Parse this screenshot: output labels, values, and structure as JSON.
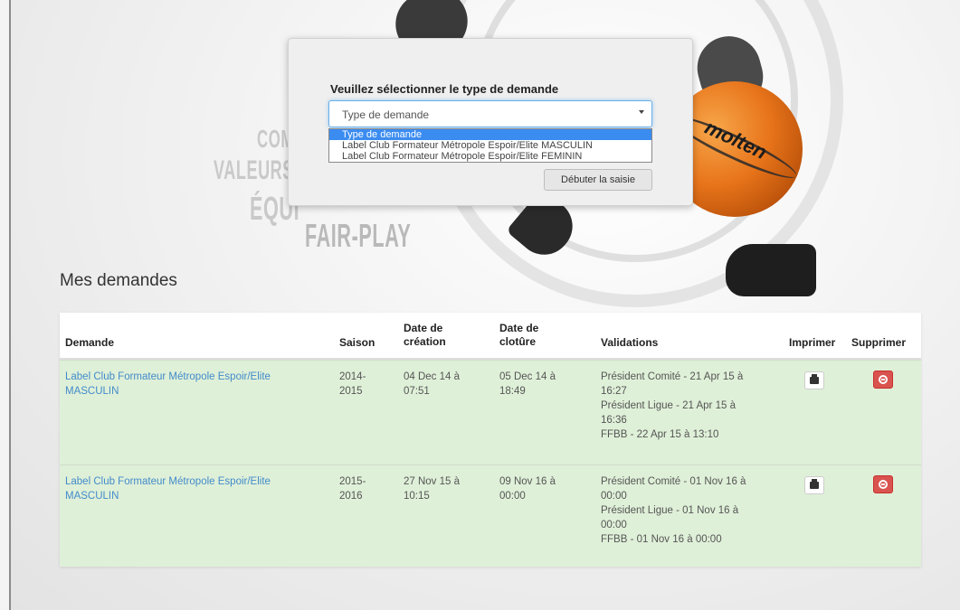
{
  "hero": {
    "words": [
      "COM",
      "VALEURS",
      "ÉQUI",
      "FAIR-PLAY"
    ],
    "ball_brand": "molten"
  },
  "modal": {
    "title": "Veuillez sélectionner le type de demande",
    "select_value": "Type de demande",
    "options": [
      "Type de demande",
      "Label Club Formateur Métropole Espoir/Elite MASCULIN",
      "Label Club Formateur Métropole Espoir/Elite FEMININ"
    ],
    "selected_option_index": 0,
    "start_button": "Débuter la saisie"
  },
  "section": {
    "title": "Mes demandes"
  },
  "table": {
    "headers": {
      "demande": "Demande",
      "saison": "Saison",
      "creation_l1": "Date de",
      "creation_l2": "création",
      "cloture_l1": "Date de",
      "cloture_l2": "clotûre",
      "validations": "Validations",
      "imprimer": "Imprimer",
      "supprimer": "Supprimer"
    },
    "rows": [
      {
        "demande_l1": "Label Club Formateur Métropole Espoir/Elite",
        "demande_l2": "MASCULIN",
        "saison_l1": "2014-",
        "saison_l2": "2015",
        "creation_l1": "04 Dec 14 à",
        "creation_l2": "07:51",
        "cloture_l1": "05 Dec 14 à",
        "cloture_l2": "18:49",
        "validations": [
          "Président Comité - 21 Apr 15 à",
          "16:27",
          "Président Ligue - 21 Apr 15 à",
          "16:36",
          "FFBB - 22 Apr 15 à 13:10"
        ]
      },
      {
        "demande_l1": "Label Club Formateur Métropole Espoir/Elite",
        "demande_l2": "MASCULIN",
        "saison_l1": "2015-",
        "saison_l2": "2016",
        "creation_l1": "27 Nov 15 à",
        "creation_l2": "10:15",
        "cloture_l1": "09 Nov 16 à",
        "cloture_l2": "00:00",
        "validations": [
          "Président Comité - 01 Nov 16 à",
          "00:00",
          "Président Ligue - 01 Nov 16 à",
          "00:00",
          "FFBB - 01 Nov 16 à 00:00"
        ]
      }
    ]
  },
  "colors": {
    "row_bg": "#dff0d8",
    "link": "#428bca",
    "delete": "#d9534f",
    "select_highlight": "#3b8cf0"
  }
}
